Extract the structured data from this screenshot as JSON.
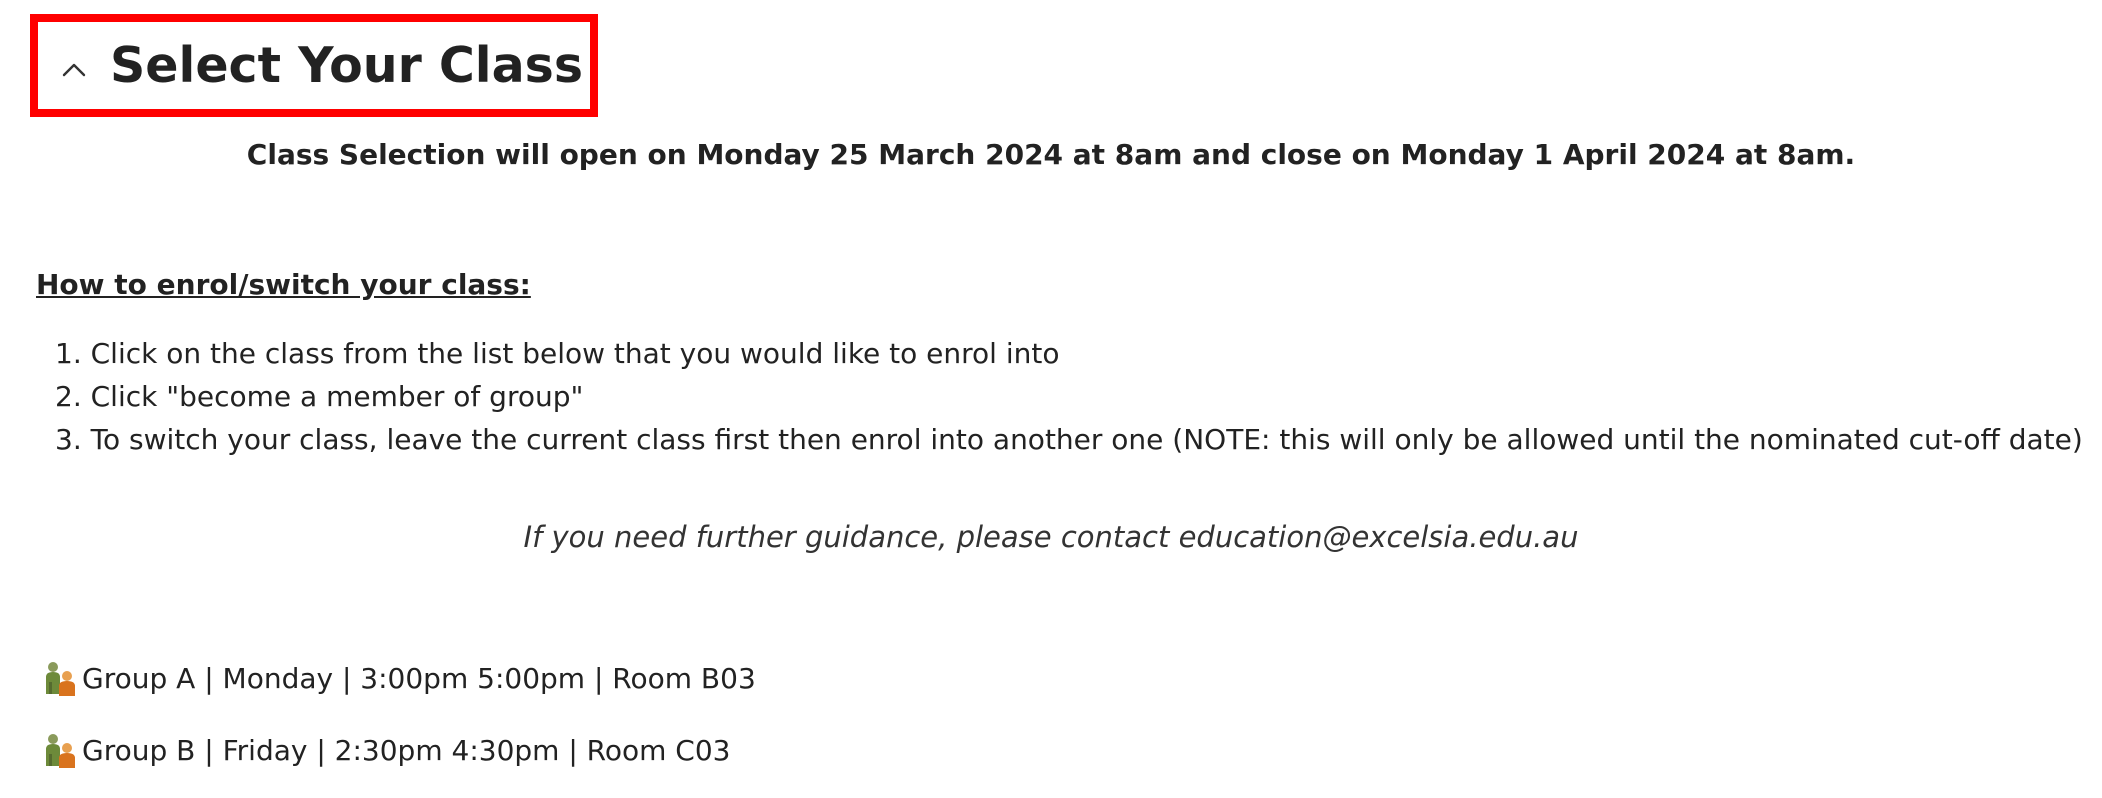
{
  "header": {
    "title": "Select Your Class",
    "toggle_icon": "chevron-up-icon",
    "highlight_color": "#ff0000"
  },
  "notice": "Class Selection will open on Monday 25 March 2024 at 8am and close on Monday 1 April 2024 at 8am.",
  "instructions": {
    "heading": "How to enrol/switch your class:",
    "steps": [
      "1. Click on the class from the list below that you would like to enrol into",
      "2. Click \"become a member of group\"",
      "3. To switch your class, leave the current class first then enrol into another one (NOTE: this will only be allowed until the nominated cut-off date)"
    ]
  },
  "guidance": "If you need further guidance, please contact education@excelsia.edu.au",
  "groups": [
    {
      "icon": "group-people-icon",
      "label": "Group A | Monday | 3:00pm 5:00pm | Room B03"
    },
    {
      "icon": "group-people-icon",
      "label": "Group B | Friday | 2:30pm 4:30pm | Room C03"
    }
  ]
}
